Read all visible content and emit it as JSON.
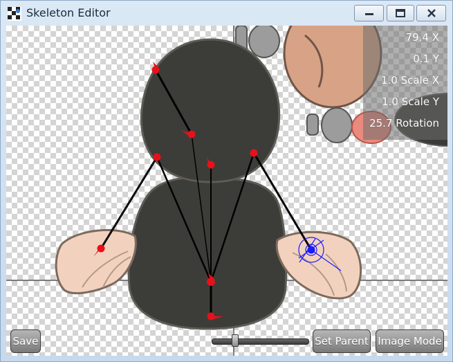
{
  "window": {
    "title": "Skeleton Editor",
    "controls": {
      "minimize": "minimize-icon",
      "maximize": "maximize-icon",
      "close": "close-icon"
    }
  },
  "readouts": {
    "x": "79.4 X",
    "y": "0.1 Y",
    "scale_x": "1.0 Scale X",
    "scale_y": "1.0 Scale Y",
    "rotation": "25.7 Rotation"
  },
  "toolbar": {
    "save_label": "Save",
    "set_parent_label": "Set Parent",
    "image_mode_label": "Image Mode",
    "zoom_slider_fraction": 0.22
  },
  "colors": {
    "bone_joint": "#e8101a",
    "selected_joint": "#1a1aff",
    "body": "#3c3d38",
    "wing": "#f2d2bf"
  }
}
